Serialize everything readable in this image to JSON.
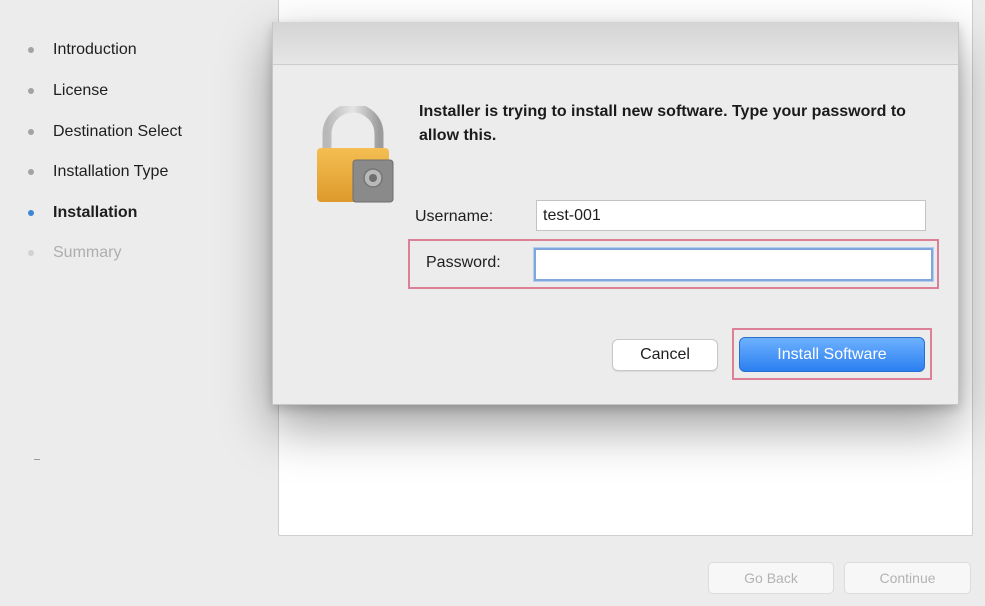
{
  "sidebar": {
    "steps": [
      {
        "label": "Introduction",
        "state": "done"
      },
      {
        "label": "License",
        "state": "done"
      },
      {
        "label": "Destination Select",
        "state": "done"
      },
      {
        "label": "Installation Type",
        "state": "done"
      },
      {
        "label": "Installation",
        "state": "current"
      },
      {
        "label": "Summary",
        "state": "pending"
      }
    ]
  },
  "navigation": {
    "go_back_label": "Go Back",
    "continue_label": "Continue"
  },
  "auth_dialog": {
    "icon": "lock-icon",
    "message": "Installer is trying to install new software. Type your password to allow this.",
    "username_label": "Username:",
    "username_value": "test-001",
    "password_label": "Password:",
    "password_value": "",
    "cancel_label": "Cancel",
    "install_label": "Install Software"
  },
  "colors": {
    "accent": "#3d86d6",
    "install_button": "#2b7ff0",
    "highlight_box": "#dc8097",
    "lock_body": "#e8a93b"
  }
}
